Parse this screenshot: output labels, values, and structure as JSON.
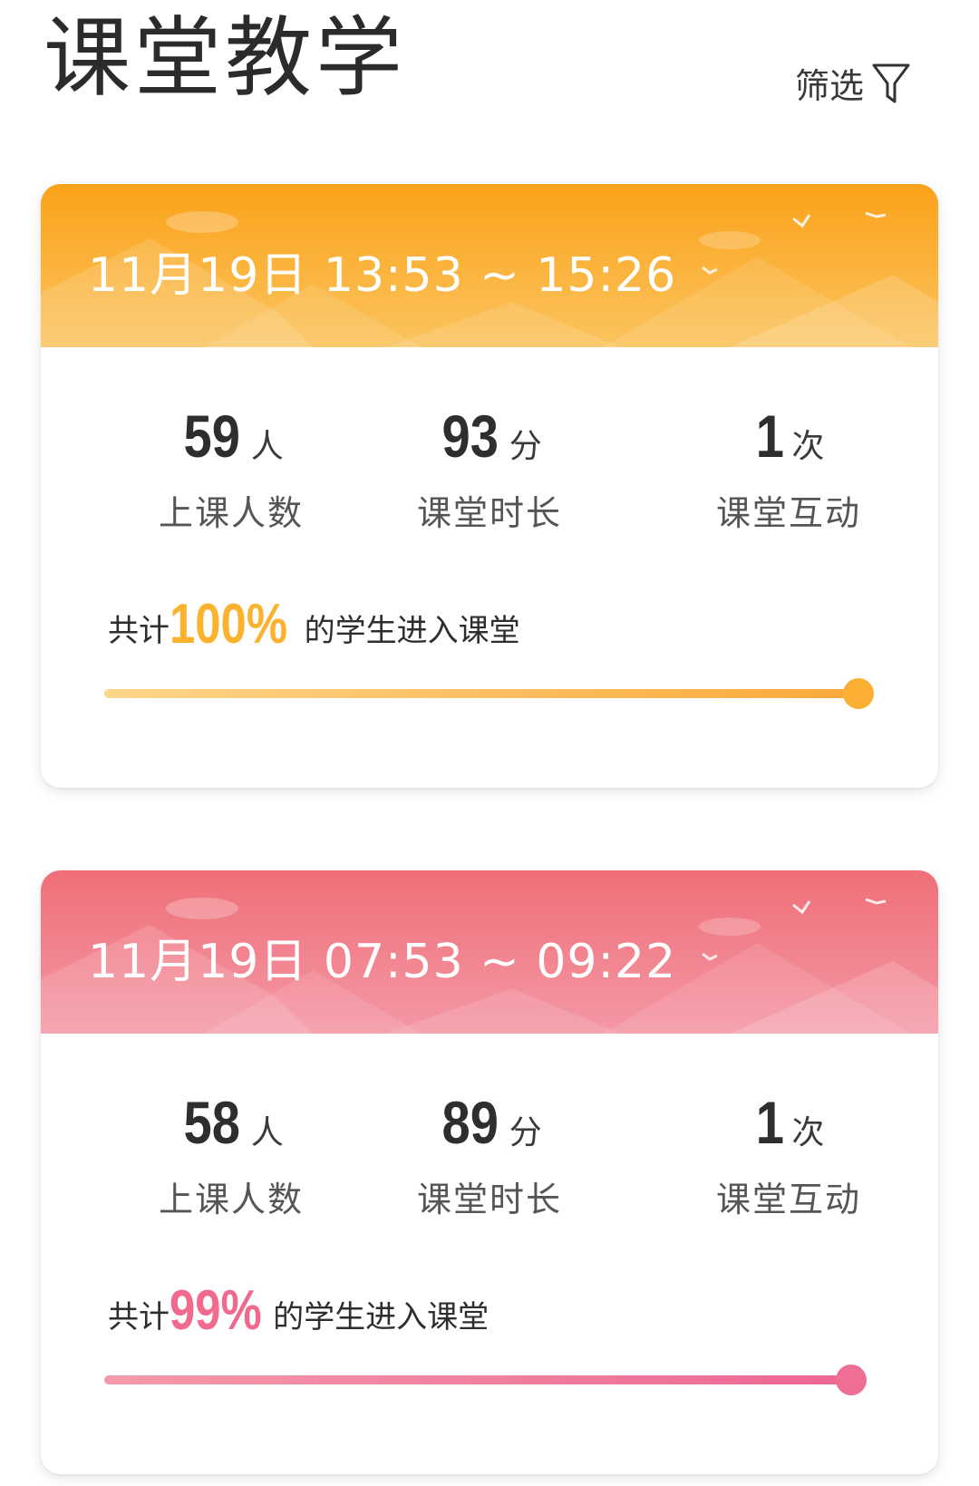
{
  "header": {
    "title": "课堂教学",
    "filter_label": "筛选",
    "filter_icon": "funnel-icon"
  },
  "colors": {
    "orange_accent": "#fbb22f",
    "pink_accent": "#f06a8e"
  },
  "sessions": [
    {
      "time_range": "11月19日 13:53 ~ 15:26",
      "theme": "orange",
      "stats": [
        {
          "value": "59",
          "unit": "人",
          "label": "上课人数"
        },
        {
          "value": "93",
          "unit": "分",
          "label": "课堂时长"
        },
        {
          "value": "1",
          "unit": "次",
          "label": "课堂互动"
        }
      ],
      "summary_prefix": "共计",
      "summary_percent": "100%",
      "summary_suffix": "的学生进入课堂",
      "progress_fraction": 1.0
    },
    {
      "time_range": "11月19日 07:53 ~ 09:22",
      "theme": "pink",
      "stats": [
        {
          "value": "58",
          "unit": "人",
          "label": "上课人数"
        },
        {
          "value": "89",
          "unit": "分",
          "label": "课堂时长"
        },
        {
          "value": "1",
          "unit": "次",
          "label": "课堂互动"
        }
      ],
      "summary_prefix": "共计",
      "summary_percent": "99%",
      "summary_suffix": "的学生进入课堂",
      "progress_fraction": 0.99
    }
  ]
}
